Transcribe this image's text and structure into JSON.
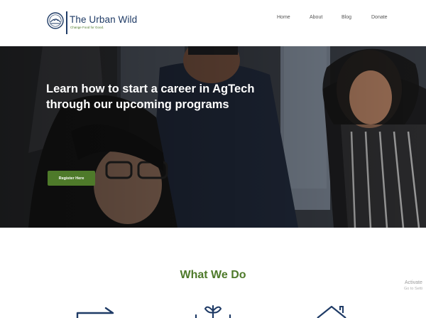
{
  "header": {
    "brand_name": "The Urban Wild",
    "tagline": "Change Food for Good.",
    "nav": [
      {
        "label": "Home"
      },
      {
        "label": "About"
      },
      {
        "label": "Blog"
      },
      {
        "label": "Donate"
      }
    ]
  },
  "hero": {
    "title_line1": "Learn how to start a career in AgTech",
    "title_line2": "through our upcoming programs",
    "cta_label": "Register Here"
  },
  "section": {
    "title": "What We Do",
    "icons": [
      "arrow-right-icon",
      "plant-sprout-icon",
      "house-icon"
    ]
  },
  "system_overlay": {
    "line1": "Activate",
    "line2": "Go to Setti"
  },
  "colors": {
    "brand_navy": "#1f3b66",
    "brand_green": "#4e7a2a",
    "nav_text": "#555555"
  }
}
